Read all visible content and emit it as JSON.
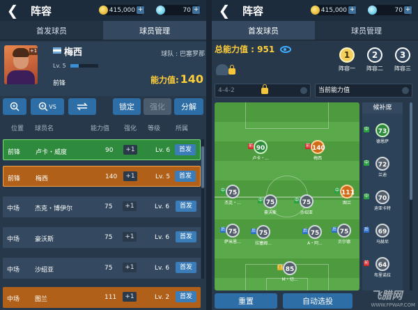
{
  "left": {
    "title": "阵容",
    "coins": "415,000",
    "gems": "70",
    "tabs": [
      "首发球员",
      "球员管理"
    ],
    "card": {
      "name": "梅西",
      "club": "球队 : 巴塞罗那",
      "level": "Lv. 5",
      "position": "前锋",
      "ability_label": "能力值:",
      "ability_value": "140",
      "level_progress": 0.3
    },
    "actions": [
      "锁定",
      "强化",
      "分解"
    ],
    "headers": [
      "位置",
      "球员名",
      "能力值",
      "强化",
      "等级",
      "所属"
    ],
    "rows": [
      {
        "pos": "前锋",
        "name": "卢卡・威度",
        "ability": "90",
        "plus": "+1",
        "level": "Lv. 6",
        "status": "首发",
        "style": "green"
      },
      {
        "pos": "前锋",
        "name": "梅西",
        "ability": "140",
        "plus": "+1",
        "level": "Lv. 5",
        "status": "首发",
        "style": "orange"
      },
      {
        "pos": "中场",
        "name": "杰克・博伊尔",
        "ability": "75",
        "plus": "+1",
        "level": "Lv. 6",
        "status": "首发",
        "style": "normal"
      },
      {
        "pos": "中场",
        "name": "豪沃斯",
        "ability": "75",
        "plus": "+1",
        "level": "Lv. 6",
        "status": "首发",
        "style": "normal"
      },
      {
        "pos": "中场",
        "name": "沙绍亚",
        "ability": "75",
        "plus": "+1",
        "level": "Lv. 6",
        "status": "首发",
        "style": "normal"
      },
      {
        "pos": "中场",
        "name": "图兰",
        "ability": "111",
        "plus": "+1",
        "level": "Lv. 2",
        "status": "首发",
        "style": "orange2"
      }
    ]
  },
  "right": {
    "title": "阵容",
    "coins": "415,000",
    "gems": "70",
    "tabs": [
      "首发球员",
      "球员管理"
    ],
    "total_label": "总能力值 : 951",
    "lineups": [
      {
        "num": "1",
        "label": "阵容一"
      },
      {
        "num": "2",
        "label": "阵容二"
      },
      {
        "num": "3",
        "label": "阵容三"
      }
    ],
    "formation": "4-4-2",
    "sort": "当前能力值",
    "bench_title": "候补席",
    "pitch_players": [
      {
        "tag": "前",
        "tagc": "tag-red",
        "val": "90",
        "color": "c-green",
        "name": "卢卡・..."
      },
      {
        "tag": "前",
        "tagc": "tag-red",
        "val": "140",
        "color": "c-orange",
        "name": "梅西"
      },
      {
        "tag": "中",
        "tagc": "tag-green",
        "val": "75",
        "color": "c-gray",
        "name": "杰克・..."
      },
      {
        "tag": "中",
        "tagc": "tag-green",
        "val": "75",
        "color": "c-gray",
        "name": "豪沃斯"
      },
      {
        "tag": "中",
        "tagc": "tag-green",
        "val": "75",
        "color": "c-gray",
        "name": "沙绍亚"
      },
      {
        "tag": "中",
        "tagc": "tag-green",
        "val": "111",
        "color": "c-orange",
        "name": "图兰"
      },
      {
        "tag": "后",
        "tagc": "tag-blue",
        "val": "75",
        "color": "c-gray",
        "name": "萨米恩..."
      },
      {
        "tag": "后",
        "tagc": "tag-blue",
        "val": "75",
        "color": "c-gray",
        "name": "拉塞姆..."
      },
      {
        "tag": "后",
        "tagc": "tag-blue",
        "val": "75",
        "color": "c-gray",
        "name": "A・阿..."
      },
      {
        "tag": "后",
        "tagc": "tag-blue",
        "val": "75",
        "color": "c-gray",
        "name": "贝尔德"
      },
      {
        "tag": "门",
        "tagc": "tag-yellow",
        "val": "85",
        "color": "c-gray",
        "name": "M・切..."
      }
    ],
    "bench": [
      {
        "tag": "中",
        "tagc": "tag-green",
        "val": "73",
        "color": "c-green",
        "name": "德恩萨"
      },
      {
        "tag": "中",
        "tagc": "tag-green",
        "val": "72",
        "color": "c-gray",
        "name": "兰迪"
      },
      {
        "tag": "中",
        "tagc": "tag-green",
        "val": "70",
        "color": "c-gray",
        "name": "迪亚卡特"
      },
      {
        "tag": "后",
        "tagc": "tag-blue",
        "val": "69",
        "color": "c-gray",
        "name": "马赫尼"
      },
      {
        "tag": "前",
        "tagc": "tag-red",
        "val": "64",
        "color": "c-gray",
        "name": "布里诺拉"
      }
    ],
    "buttons": [
      "重置",
      "自动选投"
    ]
  },
  "watermark": {
    "logo": "飞腊网",
    "url": "WWW.FPWAP.COM"
  }
}
